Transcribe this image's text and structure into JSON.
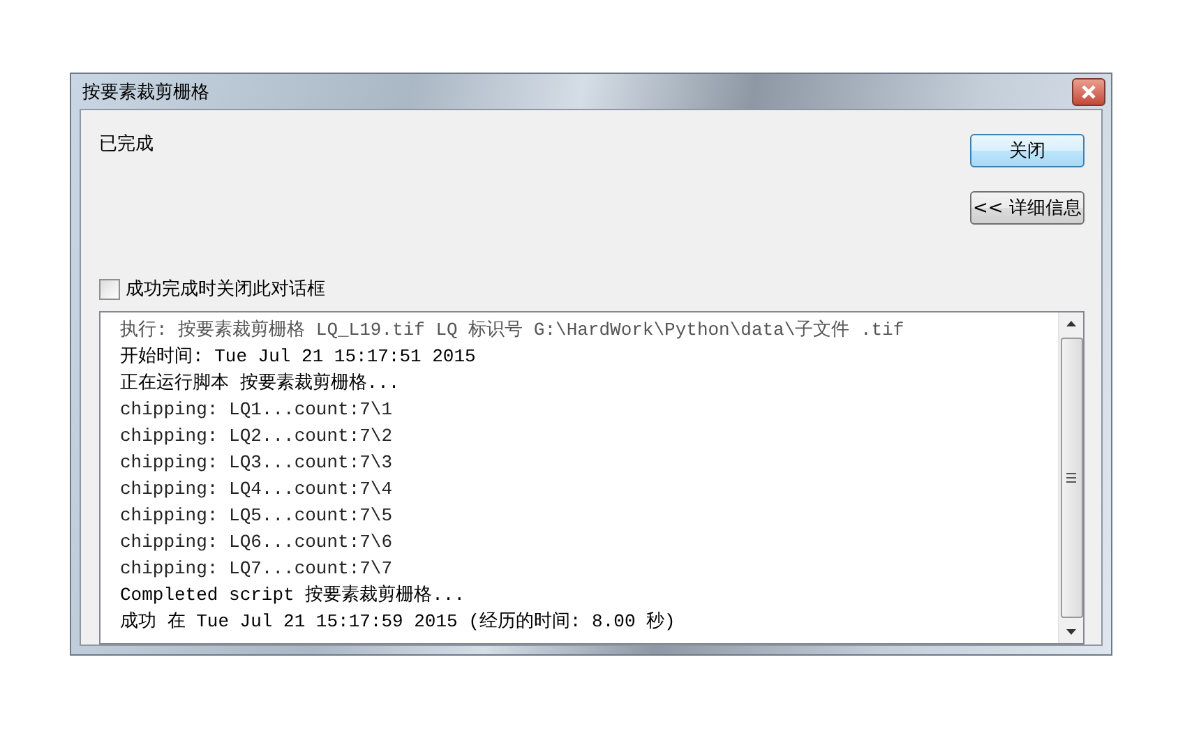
{
  "window": {
    "title": "按要素裁剪栅格"
  },
  "status": "已完成",
  "buttons": [
    {
      "label": "关闭",
      "default": true
    },
    {
      "label": "<< 详细信息",
      "default": false
    }
  ],
  "close_on_success": {
    "label": "成功完成时关闭此对话框",
    "checked": false
  },
  "log": [
    {
      "kind": "command",
      "text": "执行: 按要素裁剪栅格 LQ_L19.tif LQ 标识号 G:\\HardWork\\Python\\data\\子文件 .tif"
    },
    {
      "kind": "info",
      "text": "开始时间: Tue Jul 21 15:17:51 2015"
    },
    {
      "kind": "info",
      "text": "正在运行脚本 按要素裁剪栅格..."
    },
    {
      "kind": "output",
      "text": "chipping: LQ1...count:7\\1"
    },
    {
      "kind": "output",
      "text": "chipping: LQ2...count:7\\2"
    },
    {
      "kind": "output",
      "text": "chipping: LQ3...count:7\\3"
    },
    {
      "kind": "output",
      "text": "chipping: LQ4...count:7\\4"
    },
    {
      "kind": "output",
      "text": "chipping: LQ5...count:7\\5"
    },
    {
      "kind": "output",
      "text": "chipping: LQ6...count:7\\6"
    },
    {
      "kind": "output",
      "text": "chipping: LQ7...count:7\\7"
    },
    {
      "kind": "info",
      "text": "Completed script 按要素裁剪栅格..."
    },
    {
      "kind": "info",
      "text": "成功 在 Tue Jul 21 15:17:59 2015 (经历的时间: 8.00 秒)"
    }
  ]
}
